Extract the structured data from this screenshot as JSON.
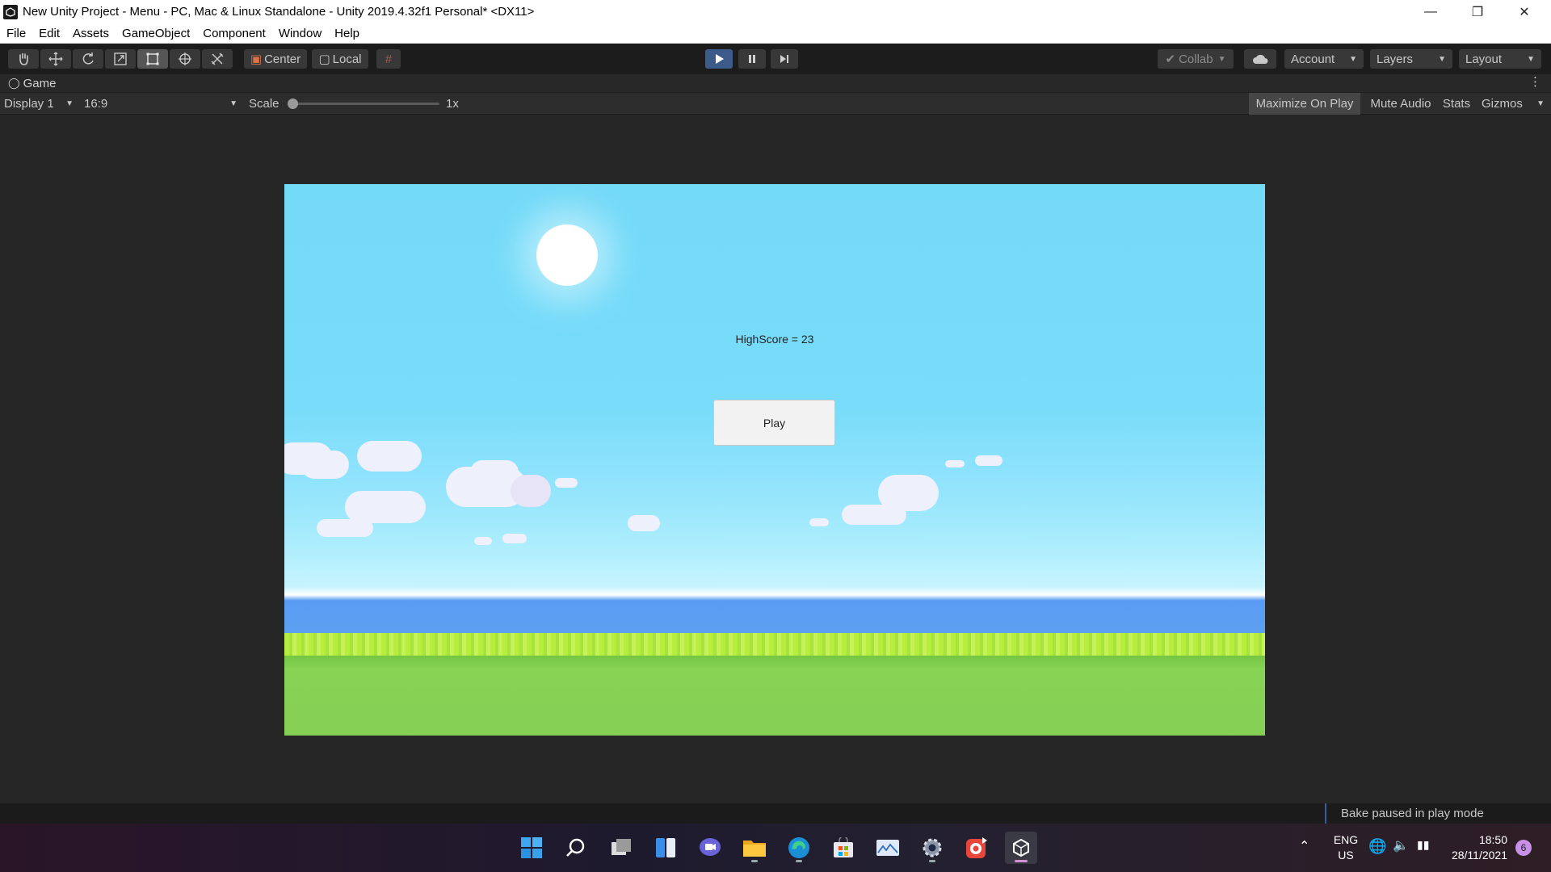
{
  "window": {
    "title": "New Unity Project - Menu - PC, Mac & Linux Standalone - Unity 2019.4.32f1 Personal* <DX11>"
  },
  "menu": [
    "File",
    "Edit",
    "Assets",
    "GameObject",
    "Component",
    "Window",
    "Help"
  ],
  "toolbar": {
    "tools": [
      "hand-tool-icon",
      "move-tool-icon",
      "rotate-tool-icon",
      "scale-tool-icon",
      "rect-tool-icon",
      "transform-tool-icon",
      "custom-tool-icon"
    ],
    "pivot_label": "Center",
    "space_label": "Local",
    "collab_label": "Collab",
    "account_label": "Account",
    "layers_label": "Layers",
    "layout_label": "Layout"
  },
  "game_view": {
    "tab_label": "Game",
    "display": "Display 1",
    "aspect": "16:9",
    "scale_label": "Scale",
    "scale_value": "1x",
    "scale_fraction": 0.0,
    "maximize_label": "Maximize On Play",
    "mute_label": "Mute Audio",
    "stats_label": "Stats",
    "gizmos_label": "Gizmos"
  },
  "game": {
    "highscore_text": "HighScore = 23",
    "play_button": "Play"
  },
  "status": {
    "bake": "Bake paused in play mode"
  },
  "taskbar": {
    "apps": [
      "windows-start-icon",
      "search-icon",
      "task-view-icon",
      "widgets-icon",
      "teams-chat-icon",
      "file-explorer-icon",
      "edge-icon",
      "store-icon",
      "photos-icon",
      "settings-icon",
      "recorder-icon",
      "unity-icon"
    ],
    "language": "ENG",
    "region": "US",
    "time": "18:50",
    "date": "28/11/2021",
    "notifications": "6"
  },
  "colors": {
    "accent": "#4c7fd1",
    "sky": "#73daf8",
    "grass": "#86cf55"
  }
}
